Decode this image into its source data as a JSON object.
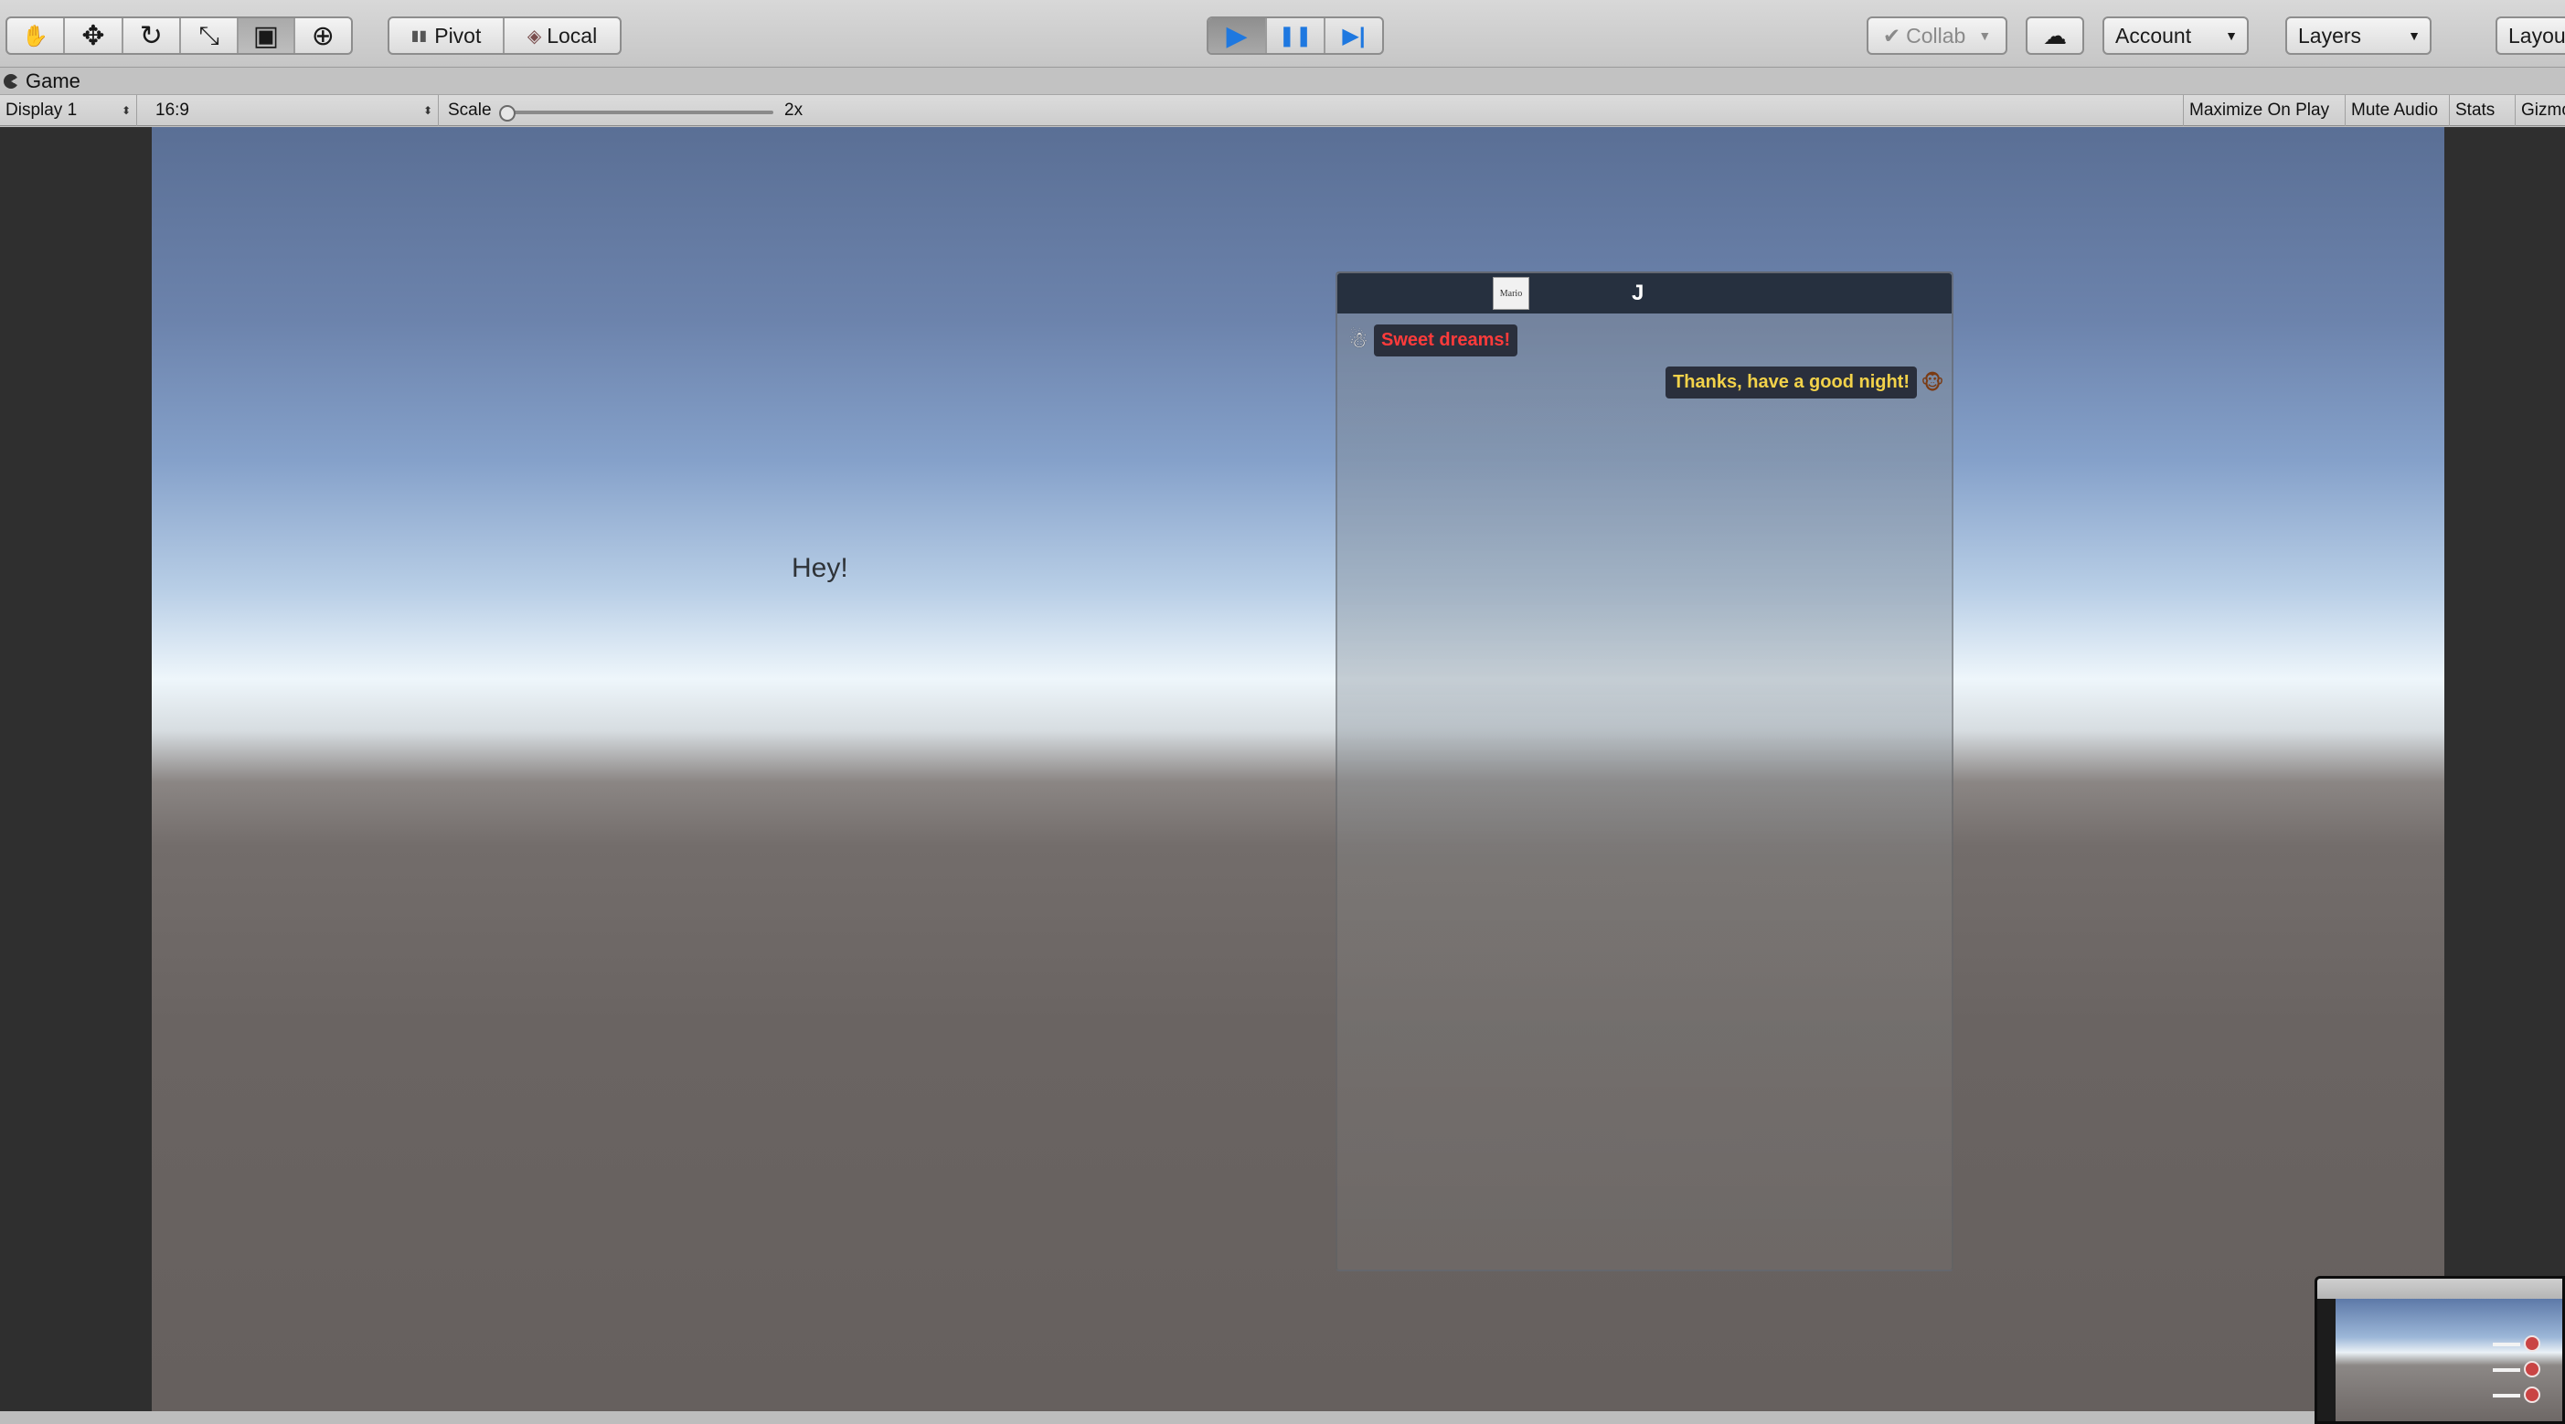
{
  "toolbar": {
    "tools": [
      {
        "name": "hand",
        "glyph": "✋"
      },
      {
        "name": "move",
        "glyph": "✥"
      },
      {
        "name": "rotate",
        "glyph": "↻"
      },
      {
        "name": "scale",
        "glyph": "⤡"
      },
      {
        "name": "rect",
        "glyph": "▣"
      },
      {
        "name": "transform",
        "glyph": "⊕"
      }
    ],
    "pivot_label": "Pivot",
    "local_label": "Local",
    "play_glyph": "▶",
    "pause_glyph": "❚❚",
    "step_glyph": "▶|",
    "collab_label": "Collab",
    "cloud_glyph": "☁",
    "account_label": "Account",
    "layers_label": "Layers",
    "layout_label": "Layout"
  },
  "tab": {
    "title": "Game"
  },
  "game_bar": {
    "display_label": "Display 1",
    "aspect_label": "16:9",
    "scale_label": "Scale",
    "scale_value": "2x",
    "maximize_label": "Maximize On Play",
    "mute_label": "Mute Audio",
    "stats_label": "Stats",
    "gizmos_label": "Gizmo"
  },
  "scene": {
    "hey_text": "Hey!"
  },
  "chat": {
    "header_icon_text": "Mario",
    "header_title": "J",
    "messages": [
      {
        "text": "Sweet dreams!",
        "color": "#ff3b3b",
        "side": "left",
        "avatar_glyph": "☃"
      },
      {
        "text": "Thanks, have a good night!",
        "color": "#f2d24a",
        "side": "right",
        "avatar_glyph": "🐵"
      }
    ]
  },
  "colors": {
    "play_accent": "#1e78e0",
    "chat_header": "#26303f"
  }
}
